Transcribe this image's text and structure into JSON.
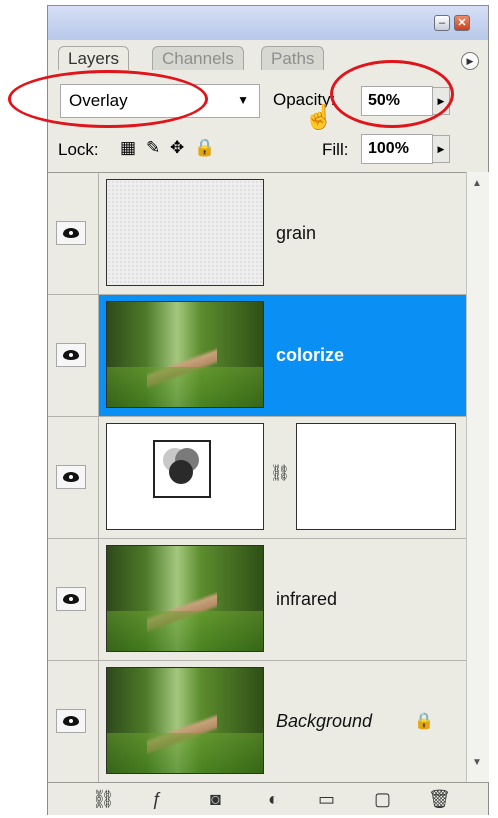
{
  "tabs": [
    {
      "label": "Layers",
      "active": true
    },
    {
      "label": "Channels",
      "active": false
    },
    {
      "label": "Paths",
      "active": false
    }
  ],
  "window_buttons": {
    "minimize": "–",
    "close": "✕"
  },
  "blend_mode": {
    "value": "Overlay"
  },
  "opacity": {
    "label": "Opacity:",
    "value": "50%"
  },
  "lock": {
    "label": "Lock:"
  },
  "fill": {
    "label": "Fill:",
    "value": "100%"
  },
  "layers": [
    {
      "name": "grain",
      "visible": true,
      "selected": false,
      "thumb": "grain"
    },
    {
      "name": "colorize",
      "visible": true,
      "selected": true,
      "thumb": "forest"
    },
    {
      "name": "",
      "visible": true,
      "selected": false,
      "thumb": "adjustment",
      "mask": true
    },
    {
      "name": "infrared",
      "visible": true,
      "selected": false,
      "thumb": "forest"
    },
    {
      "name": "Background",
      "visible": true,
      "selected": false,
      "thumb": "forest",
      "locked": true,
      "italic": true
    }
  ],
  "colors": {
    "selection": "#0a8ff5",
    "annotation": "#e0141b",
    "panel": "#ebebe4"
  },
  "icons": {
    "link": "link-layers-icon",
    "fx": "layer-style-icon",
    "mask": "add-mask-icon",
    "adjust": "new-adjustment-layer-icon",
    "folder": "new-group-icon",
    "new": "new-layer-icon",
    "trash": "delete-layer-icon"
  }
}
